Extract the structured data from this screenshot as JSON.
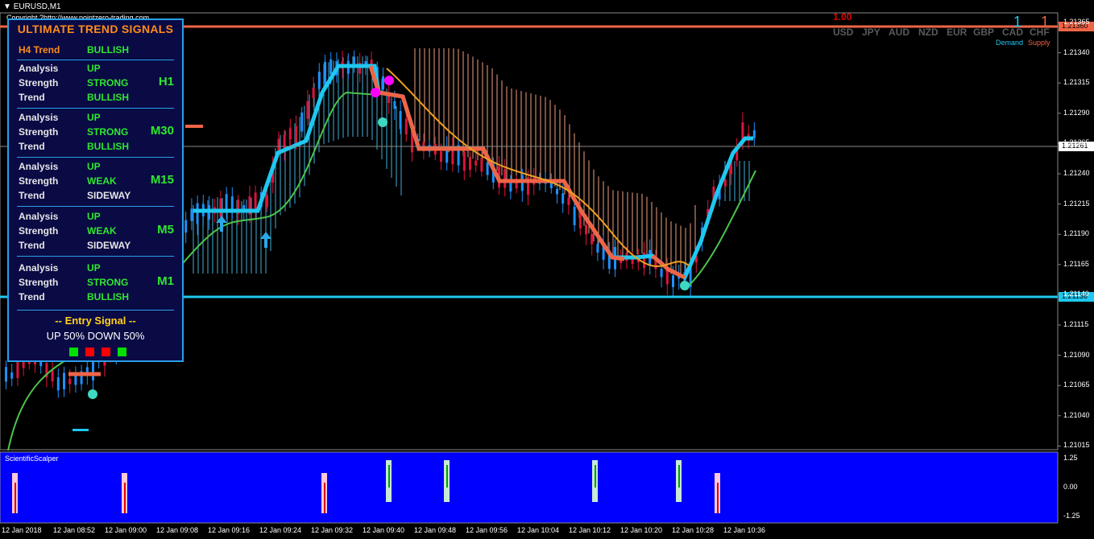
{
  "window": {
    "title": "EURUSD,M1",
    "copyright": "Copyright ?http://www.pointzero-trading.com"
  },
  "price_scale": [
    "1.21365",
    "1.21340",
    "1.21315",
    "1.21290",
    "1.21265",
    "1.21240",
    "1.21215",
    "1.21190",
    "1.21165",
    "1.21140",
    "1.21115",
    "1.21090",
    "1.21065",
    "1.21040",
    "1.21015"
  ],
  "price_tags": {
    "red_line": "1.21360",
    "current": "1.21261",
    "blue_line": "1.21136"
  },
  "time_axis": [
    "12 Jan 2018",
    "12 Jan 08:52",
    "12 Jan 09:00",
    "12 Jan 09:08",
    "12 Jan 09:16",
    "12 Jan 09:24",
    "12 Jan 09:32",
    "12 Jan 09:40",
    "12 Jan 09:48",
    "12 Jan 09:56",
    "12 Jan 10:04",
    "12 Jan 10:12",
    "12 Jan 10:20",
    "12 Jan 10:28",
    "12 Jan 10:36"
  ],
  "subwindow": {
    "title": "ScientificScalper",
    "scale": [
      "1.25",
      "0.00",
      "-1.25"
    ]
  },
  "panel": {
    "title": "ULTIMATE TREND SIGNALS",
    "h4_label": "H4 Trend",
    "h4_value": "BULLISH",
    "timeframes": [
      {
        "tf": "H1",
        "analysis": "UP",
        "strength": "STRONG",
        "trend": "BULLISH"
      },
      {
        "tf": "M30",
        "analysis": "UP",
        "strength": "STRONG",
        "trend": "BULLISH"
      },
      {
        "tf": "M15",
        "analysis": "UP",
        "strength": "WEAK",
        "trend": "SIDEWAY"
      },
      {
        "tf": "M5",
        "analysis": "UP",
        "strength": "WEAK",
        "trend": "SIDEWAY"
      },
      {
        "tf": "M1",
        "analysis": "UP",
        "strength": "STRONG",
        "trend": "BULLISH"
      }
    ],
    "labels": {
      "analysis": "Analysis",
      "strength": "Strength",
      "trend": "Trend"
    },
    "entry_title": "--  Entry Signal  --",
    "updown": "UP 50%   DOWN 50%",
    "squares": [
      "#00e000",
      "#ff0000",
      "#ff0000",
      "#00e000"
    ]
  },
  "strength_meter": {
    "value": "1.00",
    "currencies": [
      "USD",
      "JPY",
      "AUD",
      "NZD",
      "EUR",
      "GBP",
      "CAD",
      "CHF"
    ],
    "count_demand": "1",
    "count_supply": "1",
    "demand_label": "Demand",
    "supply_label": "Supply"
  },
  "colors": {
    "bull": "#1e90ff",
    "bear": "#dc143c",
    "trend_up": "#1ec8f0",
    "trend_down": "#f06446",
    "ma": "#4cc44c",
    "kumo_up": "#3fb0d8",
    "kumo_down": "#f0a080"
  }
}
